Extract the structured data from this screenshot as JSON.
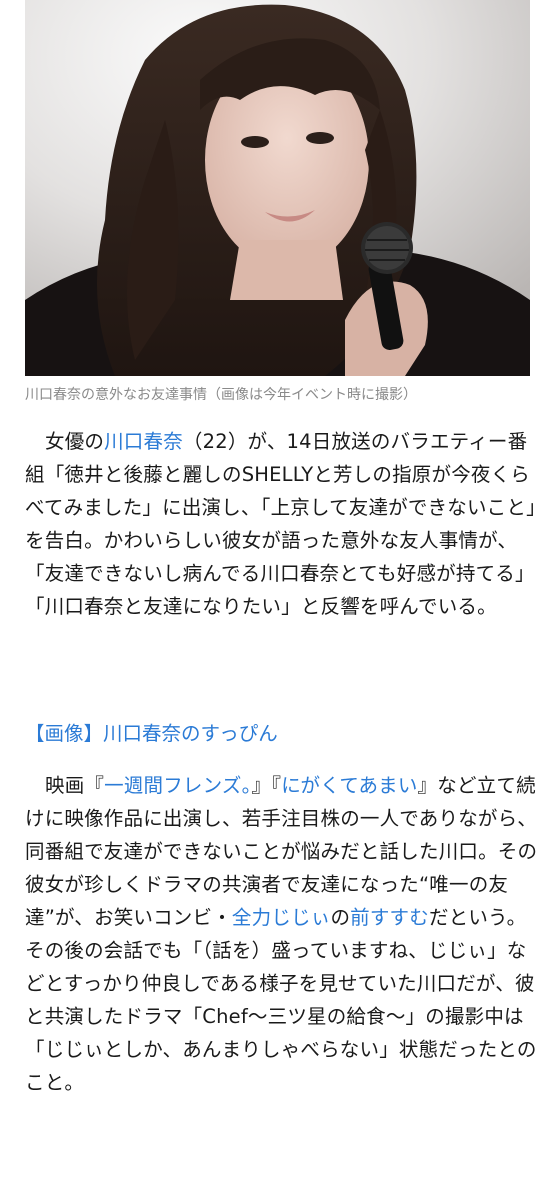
{
  "photo": {
    "alt": "川口春奈",
    "caption": "川口春奈の意外なお友達事情（画像は今年イベント時に撮影）"
  },
  "article": {
    "p1": {
      "t1": "女優の",
      "link1": "川口春奈",
      "t2": "（22）が、14日放送のバラエティー番組「徳井と後藤と麗しのSHELLYと芳しの指原が今夜くらべてみました」に出演し、「上京して友達ができないこと」を告白。かわいらしい彼女が語った意外な友人事情が、「友達できないし病んでる川口春奈とても好感が持てる」「川口春奈と友達になりたい」と反響を呼んでいる。"
    },
    "related_link": "【画像】川口春奈のすっぴん",
    "p2": {
      "t1": "映画『",
      "link1": "一週間フレンズ。",
      "t2": "』『",
      "link2": "にがくてあまい",
      "t3": "』など立て続けに映像作品に出演し、若手注目株の一人でありながら、同番組で友達ができないことが悩みだと話した川口。その彼女が珍しくドラマの共演者で友達になった“唯一の友達”が、お笑いコンビ・",
      "link3": "全力じじぃ",
      "t4": "の",
      "link4": "前すすむ",
      "t5": "だという。その後の会話でも「（話を）盛っていますね、じじぃ」などとすっかり仲良しである様子を見せていた川口だが、彼と共演したドラマ「Chef〜三ツ星の給食〜」の撮影中は「じじぃとしか、あんまりしゃべらない」状態だったとのこと。"
    }
  },
  "colors": {
    "link": "#2b7bd6",
    "caption": "#8a8a8a",
    "text": "#1a1a1a"
  }
}
